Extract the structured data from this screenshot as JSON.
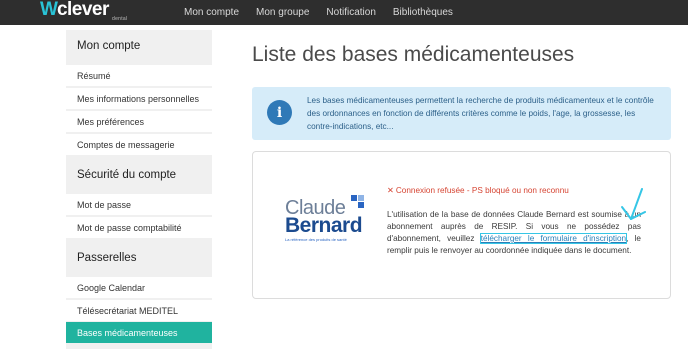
{
  "brand": {
    "mark": "W",
    "name": "clever",
    "sub": "dental"
  },
  "nav": {
    "items": [
      "Mon compte",
      "Mon groupe",
      "Notification",
      "Bibliothèques"
    ]
  },
  "sidebar": {
    "sections": [
      {
        "title": "Mon compte",
        "items": [
          "Résumé",
          "Mes informations personnelles",
          "Mes préférences",
          "Comptes de messagerie"
        ]
      },
      {
        "title": "Sécurité du compte",
        "items": [
          "Mot de passe",
          "Mot de passe comptabilité"
        ]
      },
      {
        "title": "Passerelles",
        "items": [
          "Google Calendar",
          "Télésecrétariat MEDITEL",
          "Bases médicamenteuses"
        ]
      }
    ],
    "active_item": "Bases médicamenteuses"
  },
  "main": {
    "title": "Liste des bases médicamenteuses",
    "info": "Les bases médicamenteuses permettent la recherche de produits médicamenteux et le contrôle des ordonnances en fonction de différents critères comme le poids, l'age, la grossesse, les contre-indications, etc...",
    "card": {
      "logo": {
        "line1": "Claude",
        "line2": "Bernard",
        "tagline": "La référence des produits de santé"
      },
      "error": "Connexion refusée - PS bloqué ou non reconnu",
      "desc_before": "L'utilisation de la base de données Claude Bernard est soumise à un abonnement auprès de RESIP. Si vous ne possédez pas d'abonnement, veuillez ",
      "desc_link": "télécharger le formulaire d'inscription",
      "desc_after": ", le remplir puis le renvoyer au coordonnée indiquée dans le document."
    }
  },
  "colors": {
    "accent": "#20b39f",
    "navbar": "#2e2e2e",
    "info_bg": "#d6ecf9",
    "error": "#d64432",
    "annotation": "#35c6e6"
  }
}
